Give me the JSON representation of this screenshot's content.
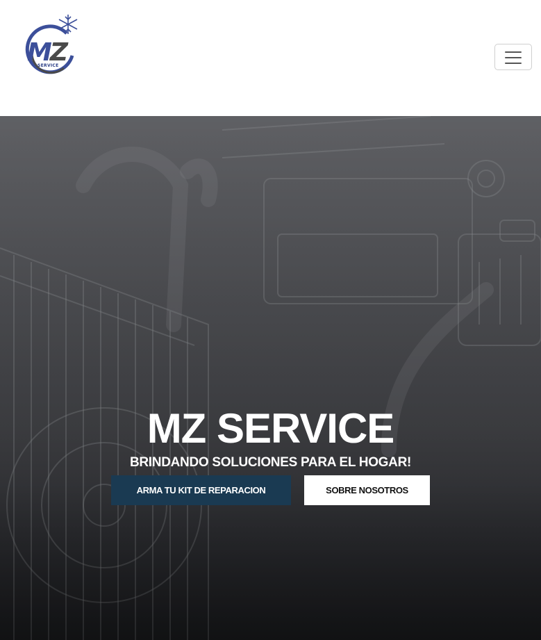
{
  "brand": {
    "logo_letters_m": "M",
    "logo_letters_z": "Z",
    "logo_small_text": "SERVICE",
    "logo_icon": "snowflake-icon"
  },
  "nav": {
    "toggler_icon": "hamburger-menu-icon"
  },
  "hero": {
    "title": "MZ SERVICE",
    "subtitle": "BRINDANDO SOLUCIONES PARA EL HOGAR!",
    "primary_button": "ARMA TU KIT DE REPARACION",
    "secondary_button": "SOBRE NOSOTROS"
  },
  "colors": {
    "brand_blue": "#3c4f9a",
    "primary_button_bg": "#1a3a52",
    "hero_overlay": "#4c4d51"
  }
}
